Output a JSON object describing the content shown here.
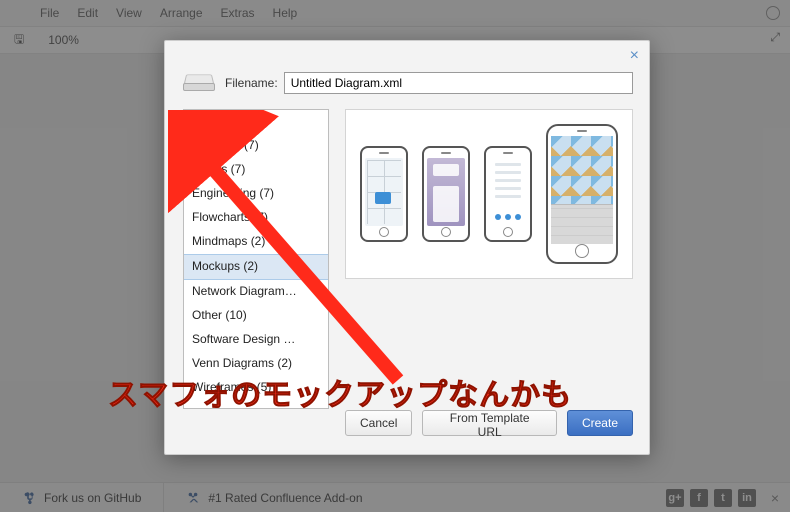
{
  "menu": {
    "file": "File",
    "edit": "Edit",
    "view": "View",
    "arrange": "Arrange",
    "extras": "Extras",
    "help": "Help"
  },
  "zoom": "100%",
  "fullscreen_icon": "⤢",
  "dialog": {
    "close": "×",
    "filename_label": "Filename:",
    "filename_value": "Untitled Diagram.xml",
    "categories": [
      "Basic (1)",
      "Business (7)",
      "Charts (7)",
      "Engineering (7)",
      "Flowcharts (7)",
      "Mindmaps (2)",
      "Mockups (2)",
      "Network Diagram…",
      "Other (10)",
      "Software Design …",
      "Venn Diagrams (2)",
      "Wireframes (5)"
    ],
    "selected_index": 6,
    "buttons": {
      "cancel": "Cancel",
      "from_template": "From Template URL",
      "create": "Create"
    }
  },
  "annotation": "スマフォのモックアップなんかも",
  "footer": {
    "fork": "Fork us on GitHub",
    "confluence": "#1 Rated Confluence Add-on",
    "social": [
      "g+",
      "f",
      "t",
      "in"
    ],
    "close": "×"
  }
}
